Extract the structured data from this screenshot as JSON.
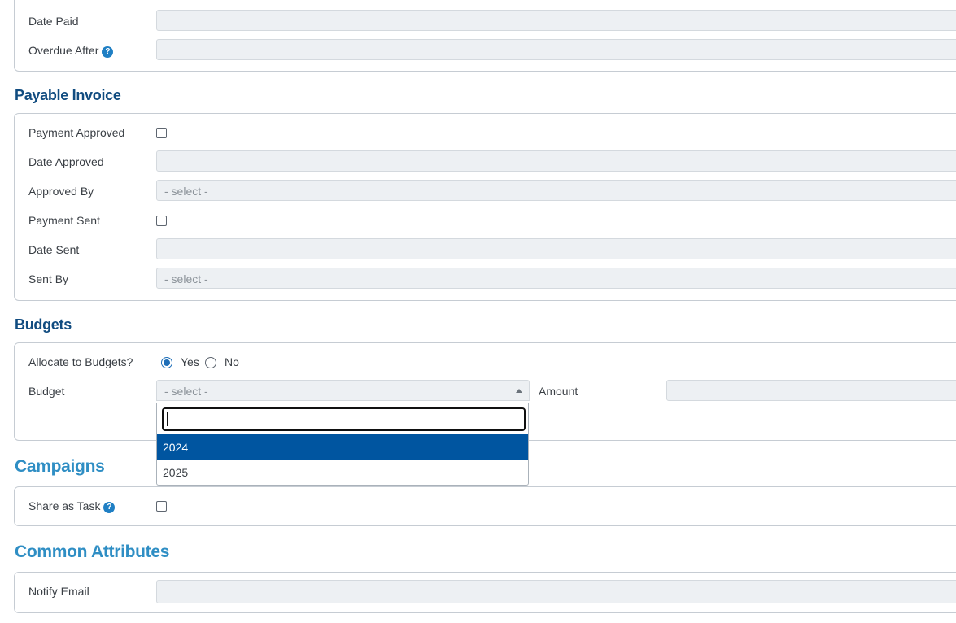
{
  "invoice": {
    "date_paid_label": "Date Paid",
    "overdue_after_label": "Overdue After"
  },
  "payable_invoice": {
    "title": "Payable Invoice",
    "payment_approved_label": "Payment Approved",
    "date_approved_label": "Date Approved",
    "approved_by_label": "Approved By",
    "approved_by_value": "- select -",
    "payment_sent_label": "Payment Sent",
    "date_sent_label": "Date Sent",
    "sent_by_label": "Sent By",
    "sent_by_value": "- select -"
  },
  "budgets": {
    "title": "Budgets",
    "allocate_label": "Allocate to Budgets?",
    "yes_label": "Yes",
    "no_label": "No",
    "allocate_selected": "Yes",
    "budget_label": "Budget",
    "budget_value": "- select -",
    "amount_label": "Amount",
    "dropdown": {
      "search_value": "",
      "options": [
        "2024",
        "2025"
      ],
      "highlighted": "2024"
    }
  },
  "campaigns": {
    "title": "Campaigns",
    "share_as_task_label": "Share as Task"
  },
  "common_attributes": {
    "title": "Common Attributes",
    "notify_email_label": "Notify Email"
  },
  "icons": {
    "help": "question-circle-icon",
    "dropdown_arrow": "caret-up-icon"
  },
  "help_glyph": "?",
  "colors": {
    "section_title_dark": "#114c80",
    "section_title_light": "#2f8ec4",
    "highlight": "#0055a0",
    "help_icon": "#1f7fc4"
  }
}
